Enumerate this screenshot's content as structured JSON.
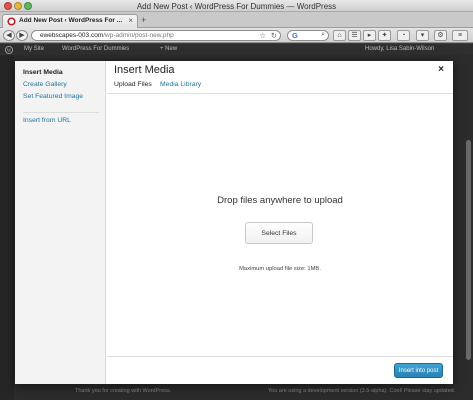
{
  "browser": {
    "window_title": "Add New Post ‹ WordPress For Dummies — WordPress",
    "tab_title": "Add New Post ‹ WordPress For ...",
    "new_tab_symbol": "+",
    "url_host": "ewebscapes-003.com",
    "url_path": "/wp-admin/post-new.php",
    "search_placeholder": "G"
  },
  "admin_bar": {
    "site_name": "My Site",
    "site_title": "WordPress For Dummies",
    "new_label": "+ New",
    "greeting": "Howdy, Lisa Sabin-Wilson"
  },
  "modal": {
    "title": "Insert Media",
    "close_symbol": "×",
    "menu": {
      "items": [
        {
          "label": "Insert Media"
        },
        {
          "label": "Create Gallery"
        },
        {
          "label": "Set Featured Image"
        },
        {
          "label": "Insert from URL"
        }
      ]
    },
    "tabs": [
      {
        "label": "Upload Files"
      },
      {
        "label": "Media Library"
      }
    ],
    "uploader": {
      "drop_text": "Drop files anywhere to upload",
      "button_label": "Select Files",
      "max_size_text": "Maximum upload file size: 1MB."
    },
    "toolbar": {
      "insert_label": "Insert into post"
    }
  },
  "footer": {
    "left_text": "Thank you for creating with WordPress.",
    "right_text": "You are using a development version (3.5-alpha). Cool! Please stay updated."
  },
  "colors": {
    "link": "#21759b",
    "primary_button": "#2a8bc0",
    "admin_bar": "#2f2f2f"
  }
}
